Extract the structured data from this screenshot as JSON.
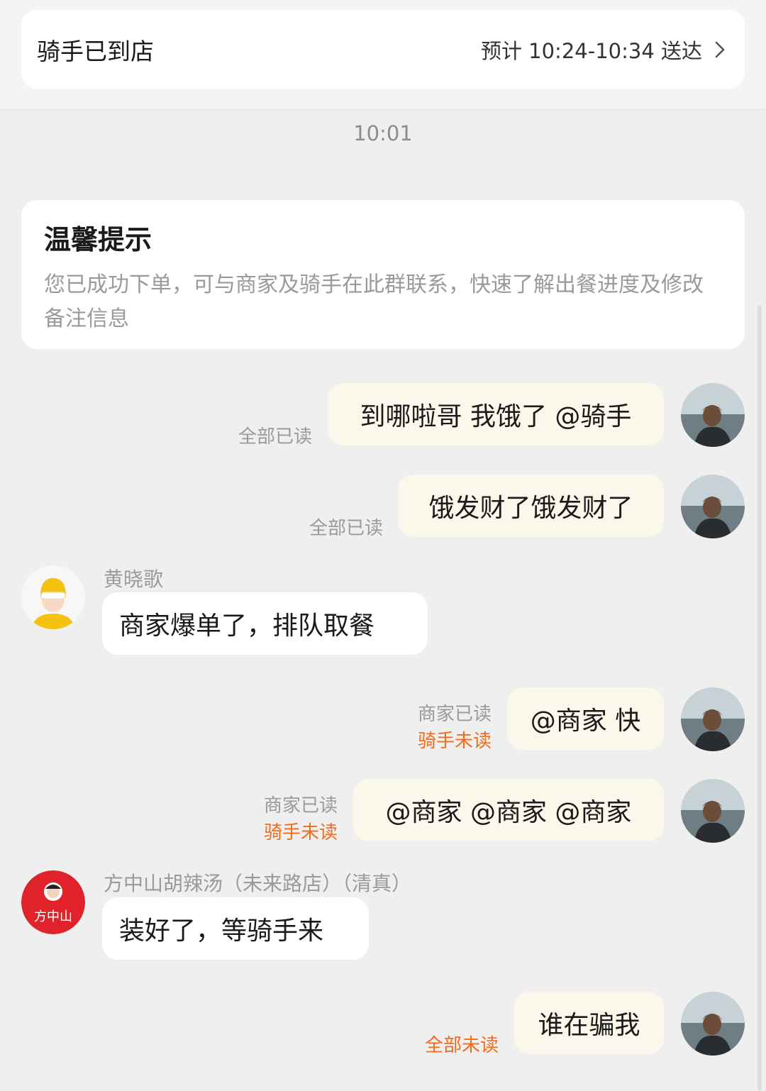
{
  "header": {
    "status": "骑手已到店",
    "eta": "预计 10:24-10:34 送达"
  },
  "timestamp": "10:01",
  "tip": {
    "title": "温馨提示",
    "body": "您已成功下单，可与商家及骑手在此群联系，快速了解出餐进度及修改备注信息"
  },
  "messages": [
    {
      "side": "right",
      "text": "到哪啦哥 我饿了 @骑手",
      "read_status": [
        "全部已读"
      ]
    },
    {
      "side": "right",
      "text": "饿发财了饿发财了",
      "read_status": [
        "全部已读"
      ]
    },
    {
      "side": "left",
      "sender": "黄晓歌",
      "text": "商家爆单了，排队取餐"
    },
    {
      "side": "right",
      "text": "@商家 快",
      "read_status": [
        "商家已读",
        "骑手未读"
      ]
    },
    {
      "side": "right",
      "text": "@商家 @商家 @商家",
      "read_status": [
        "商家已读",
        "骑手未读"
      ]
    },
    {
      "side": "left",
      "sender": "方中山胡辣汤（未来路店）（清真）",
      "text": "装好了，等骑手来"
    },
    {
      "side": "right",
      "text": "谁在骗我",
      "read_status": [
        "全部未读"
      ]
    }
  ],
  "merchant_logo_text": "方中山",
  "colors": {
    "background": "#efefef",
    "my_bubble": "#fbf7ea",
    "other_bubble": "#ffffff",
    "unread": "#f26a1b",
    "read": "#9a9a9a",
    "merchant_logo": "#e0232b",
    "rider_helmet": "#f5c211"
  }
}
